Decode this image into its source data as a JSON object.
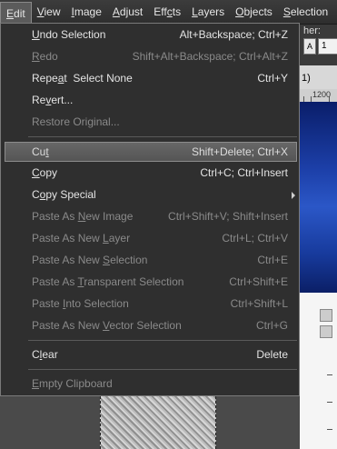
{
  "menubar": {
    "items": [
      {
        "label": "Edit",
        "u": "E",
        "rest": "dit"
      },
      {
        "label": "View",
        "u": "V",
        "rest": "iew"
      },
      {
        "label": "Image",
        "u": "I",
        "rest": "mage"
      },
      {
        "label": "Adjust",
        "u": "A",
        "rest": "djust"
      },
      {
        "label": "Effects",
        "u": "c",
        "pre": "Eff",
        "rest": "ts"
      },
      {
        "label": "Layers",
        "u": "L",
        "rest": "ayers"
      },
      {
        "label": "Objects",
        "u": "O",
        "rest": "bjects"
      },
      {
        "label": "Selections",
        "u": "S",
        "rest": "election"
      }
    ]
  },
  "background": {
    "toolbar_label": "her:",
    "tab_text": "1)",
    "ruler_text": "1200",
    "spin_value": "A",
    "field_value": "1"
  },
  "edit_menu": {
    "items": [
      {
        "pre": "",
        "u": "U",
        "post": "ndo Selection",
        "shortcut": "Alt+Backspace; Ctrl+Z",
        "state": "enabled"
      },
      {
        "pre": "",
        "u": "R",
        "post": "edo",
        "shortcut": "Shift+Alt+Backspace; Ctrl+Alt+Z",
        "state": "disabled"
      },
      {
        "pre": "Repe",
        "u": "a",
        "post": "t  Select None",
        "shortcut": "Ctrl+Y",
        "state": "enabled"
      },
      {
        "pre": "Re",
        "u": "v",
        "post": "ert...",
        "shortcut": "",
        "state": "enabled"
      },
      {
        "pre": "Restore Original...",
        "u": "",
        "post": "",
        "shortcut": "",
        "state": "disabled"
      },
      {
        "pre": "Cu",
        "u": "t",
        "post": "",
        "shortcut": "Shift+Delete; Ctrl+X",
        "state": "hover"
      },
      {
        "pre": "",
        "u": "C",
        "post": "opy",
        "shortcut": "Ctrl+C; Ctrl+Insert",
        "state": "enabled"
      },
      {
        "pre": "C",
        "u": "o",
        "post": "py Special",
        "shortcut": "",
        "state": "enabled",
        "submenu": true
      },
      {
        "pre": "Paste As ",
        "u": "N",
        "post": "ew Image",
        "shortcut": "Ctrl+Shift+V; Shift+Insert",
        "state": "disabled"
      },
      {
        "pre": "Paste As New ",
        "u": "L",
        "post": "ayer",
        "shortcut": "Ctrl+L; Ctrl+V",
        "state": "disabled"
      },
      {
        "pre": "Paste As New ",
        "u": "S",
        "post": "election",
        "shortcut": "Ctrl+E",
        "state": "disabled"
      },
      {
        "pre": "Paste As ",
        "u": "T",
        "post": "ransparent Selection",
        "shortcut": "Ctrl+Shift+E",
        "state": "disabled"
      },
      {
        "pre": "Paste ",
        "u": "I",
        "post": "nto Selection",
        "shortcut": "Ctrl+Shift+L",
        "state": "disabled"
      },
      {
        "pre": "Paste As New ",
        "u": "V",
        "post": "ector Selection",
        "shortcut": "Ctrl+G",
        "state": "disabled"
      },
      {
        "pre": "C",
        "u": "l",
        "post": "ear",
        "shortcut": "Delete",
        "state": "enabled"
      },
      {
        "pre": "",
        "u": "E",
        "post": "mpty Clipboard",
        "shortcut": "",
        "state": "disabled"
      }
    ]
  },
  "colors": {
    "menu_bg": "#2f2f2f",
    "hover_bg": "#5e5e5e",
    "enabled_text": "#e4e4e4",
    "disabled_text": "#8a8a8a",
    "canvas_blue": "#1c3fa8"
  }
}
